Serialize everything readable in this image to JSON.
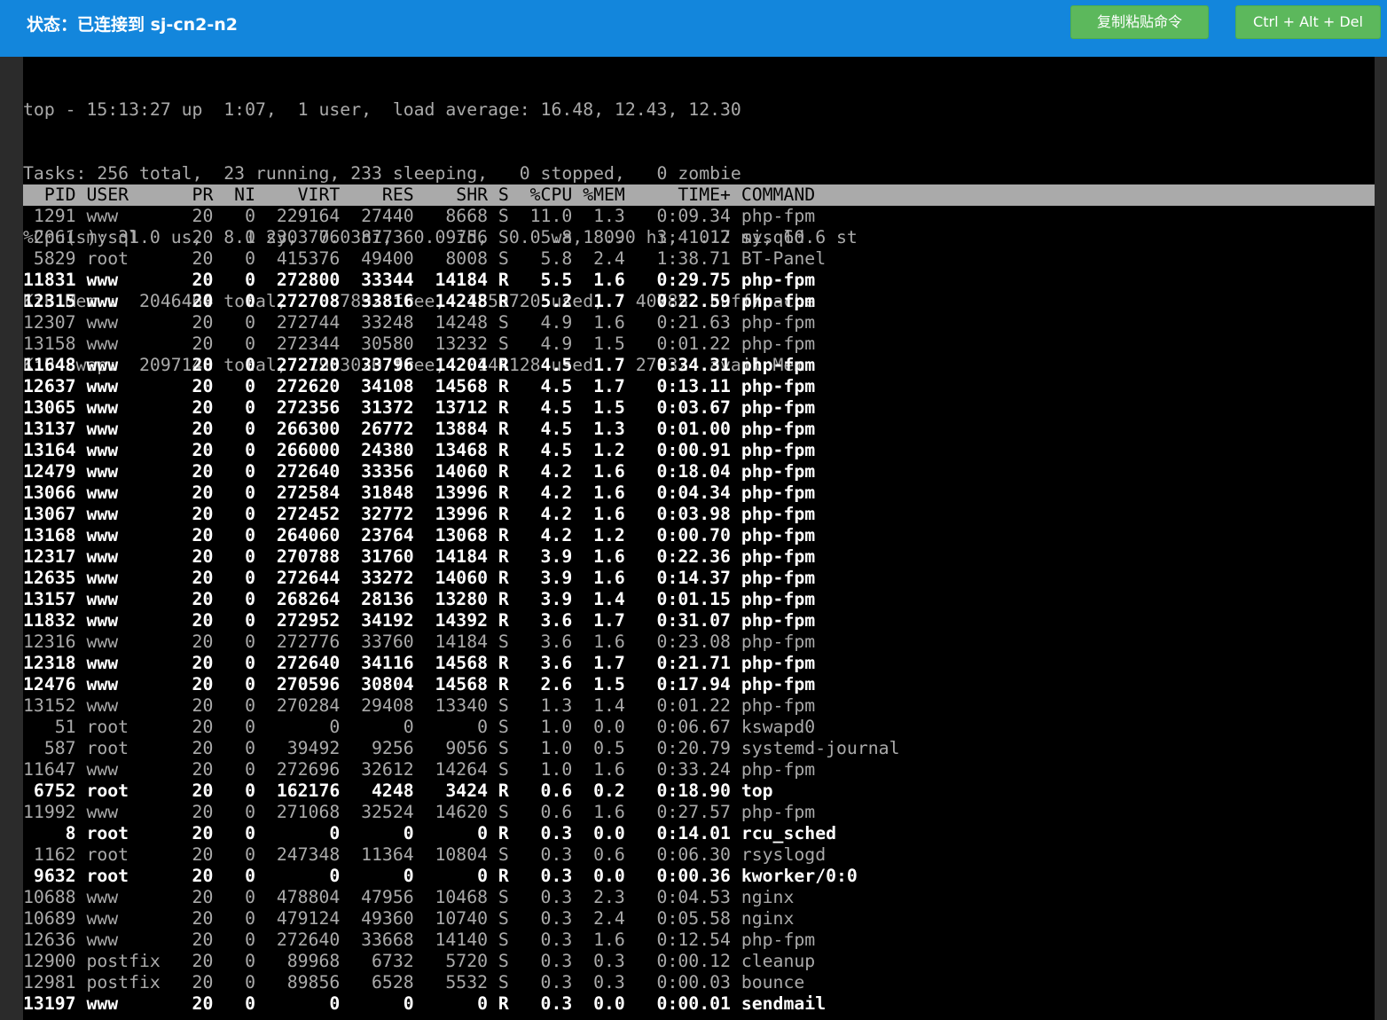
{
  "topbar": {
    "status": "状态：已连接到 sj-cn2-n2",
    "copy_button": "复制粘贴命令",
    "cad_button": "Ctrl + Alt + Del"
  },
  "summary": [
    "top - 15:13:27 up  1:07,  1 user,  load average: 16.48, 12.43, 12.30",
    "Tasks: 256 total,  23 running, 233 sleeping,   0 stopped,   0 zombie",
    "%Cpu(s): 31.0 us,  8.1 sy,  0.0 ni,  0.0 id,  0.0 wa,  0.0 hi,  0.2 si, 60.6 st",
    "KiB Mem :  2046464 total,    87892 free,  1550720 used,   407852 buff/cache",
    "KiB Swap:  2097148 total,  1953020 free,   144128 used.   278324 avail Mem"
  ],
  "header": "  PID USER      PR  NI    VIRT    RES    SHR S  %CPU %MEM     TIME+ COMMAND",
  "processes": [
    {
      "line": " 1291 www       20   0  229164  27440   8668 S  11.0  1.3   0:09.34 php-fpm",
      "running": false
    },
    {
      "line": " 2061 mysql     20   0 2303776 387736   9756 S   5.8 18.9   3:41.17 mysqld",
      "running": false
    },
    {
      "line": " 5829 root      20   0  415376  49400   8008 S   5.8  2.4   1:38.71 BT-Panel",
      "running": false
    },
    {
      "line": "11831 www       20   0  272800  33344  14184 R   5.5  1.6   0:29.75 php-fpm",
      "running": true
    },
    {
      "line": "12315 www       20   0  272708  33816  14248 R   5.2  1.7   0:22.59 php-fpm",
      "running": true
    },
    {
      "line": "12307 www       20   0  272744  33248  14248 S   4.9  1.6   0:21.63 php-fpm",
      "running": false
    },
    {
      "line": "13158 www       20   0  272344  30580  13232 S   4.9  1.5   0:01.22 php-fpm",
      "running": false
    },
    {
      "line": "11648 www       20   0  272720  33796  14204 R   4.5  1.7   0:34.31 php-fpm",
      "running": true
    },
    {
      "line": "12637 www       20   0  272620  34108  14568 R   4.5  1.7   0:13.11 php-fpm",
      "running": true
    },
    {
      "line": "13065 www       20   0  272356  31372  13712 R   4.5  1.5   0:03.67 php-fpm",
      "running": true
    },
    {
      "line": "13137 www       20   0  266300  26772  13884 R   4.5  1.3   0:01.00 php-fpm",
      "running": true
    },
    {
      "line": "13164 www       20   0  266000  24380  13468 R   4.5  1.2   0:00.91 php-fpm",
      "running": true
    },
    {
      "line": "12479 www       20   0  272640  33356  14060 R   4.2  1.6   0:18.04 php-fpm",
      "running": true
    },
    {
      "line": "13066 www       20   0  272584  31848  13996 R   4.2  1.6   0:04.34 php-fpm",
      "running": true
    },
    {
      "line": "13067 www       20   0  272452  32772  13996 R   4.2  1.6   0:03.98 php-fpm",
      "running": true
    },
    {
      "line": "13168 www       20   0  264060  23764  13068 R   4.2  1.2   0:00.70 php-fpm",
      "running": true
    },
    {
      "line": "12317 www       20   0  270788  31760  14184 R   3.9  1.6   0:22.36 php-fpm",
      "running": true
    },
    {
      "line": "12635 www       20   0  272644  33272  14060 R   3.9  1.6   0:14.37 php-fpm",
      "running": true
    },
    {
      "line": "13157 www       20   0  268264  28136  13280 R   3.9  1.4   0:01.15 php-fpm",
      "running": true
    },
    {
      "line": "11832 www       20   0  272952  34192  14392 R   3.6  1.7   0:31.07 php-fpm",
      "running": true
    },
    {
      "line": "12316 www       20   0  272776  33760  14184 S   3.6  1.6   0:23.08 php-fpm",
      "running": false
    },
    {
      "line": "12318 www       20   0  272640  34116  14568 R   3.6  1.7   0:21.71 php-fpm",
      "running": true
    },
    {
      "line": "12476 www       20   0  270596  30804  14568 R   2.6  1.5   0:17.94 php-fpm",
      "running": true
    },
    {
      "line": "13152 www       20   0  270284  29408  13340 S   1.3  1.4   0:01.22 php-fpm",
      "running": false
    },
    {
      "line": "   51 root      20   0       0      0      0 S   1.0  0.0   0:06.67 kswapd0",
      "running": false
    },
    {
      "line": "  587 root      20   0   39492   9256   9056 S   1.0  0.5   0:20.79 systemd-journal",
      "running": false
    },
    {
      "line": "11647 www       20   0  272696  32612  14264 S   1.0  1.6   0:33.24 php-fpm",
      "running": false
    },
    {
      "line": " 6752 root      20   0  162176   4248   3424 R   0.6  0.2   0:18.90 top",
      "running": true
    },
    {
      "line": "11992 www       20   0  271068  32524  14620 S   0.6  1.6   0:27.57 php-fpm",
      "running": false
    },
    {
      "line": "    8 root      20   0       0      0      0 R   0.3  0.0   0:14.01 rcu_sched",
      "running": true
    },
    {
      "line": " 1162 root      20   0  247348  11364  10804 S   0.3  0.6   0:06.30 rsyslogd",
      "running": false
    },
    {
      "line": " 9632 root      20   0       0      0      0 R   0.3  0.0   0:00.36 kworker/0:0",
      "running": true
    },
    {
      "line": "10688 www       20   0  478804  47956  10468 S   0.3  2.3   0:04.53 nginx",
      "running": false
    },
    {
      "line": "10689 www       20   0  479124  49360  10740 S   0.3  2.4   0:05.58 nginx",
      "running": false
    },
    {
      "line": "12636 www       20   0  272640  33668  14140 S   0.3  1.6   0:12.54 php-fpm",
      "running": false
    },
    {
      "line": "12900 postfix   20   0   89968   6732   5720 S   0.3  0.3   0:00.12 cleanup",
      "running": false
    },
    {
      "line": "12981 postfix   20   0   89856   6528   5532 S   0.3  0.3   0:00.03 bounce",
      "running": false
    },
    {
      "line": "13197 www       20   0       0      0      0 R   0.3  0.0   0:00.01 sendmail",
      "running": true
    }
  ]
}
